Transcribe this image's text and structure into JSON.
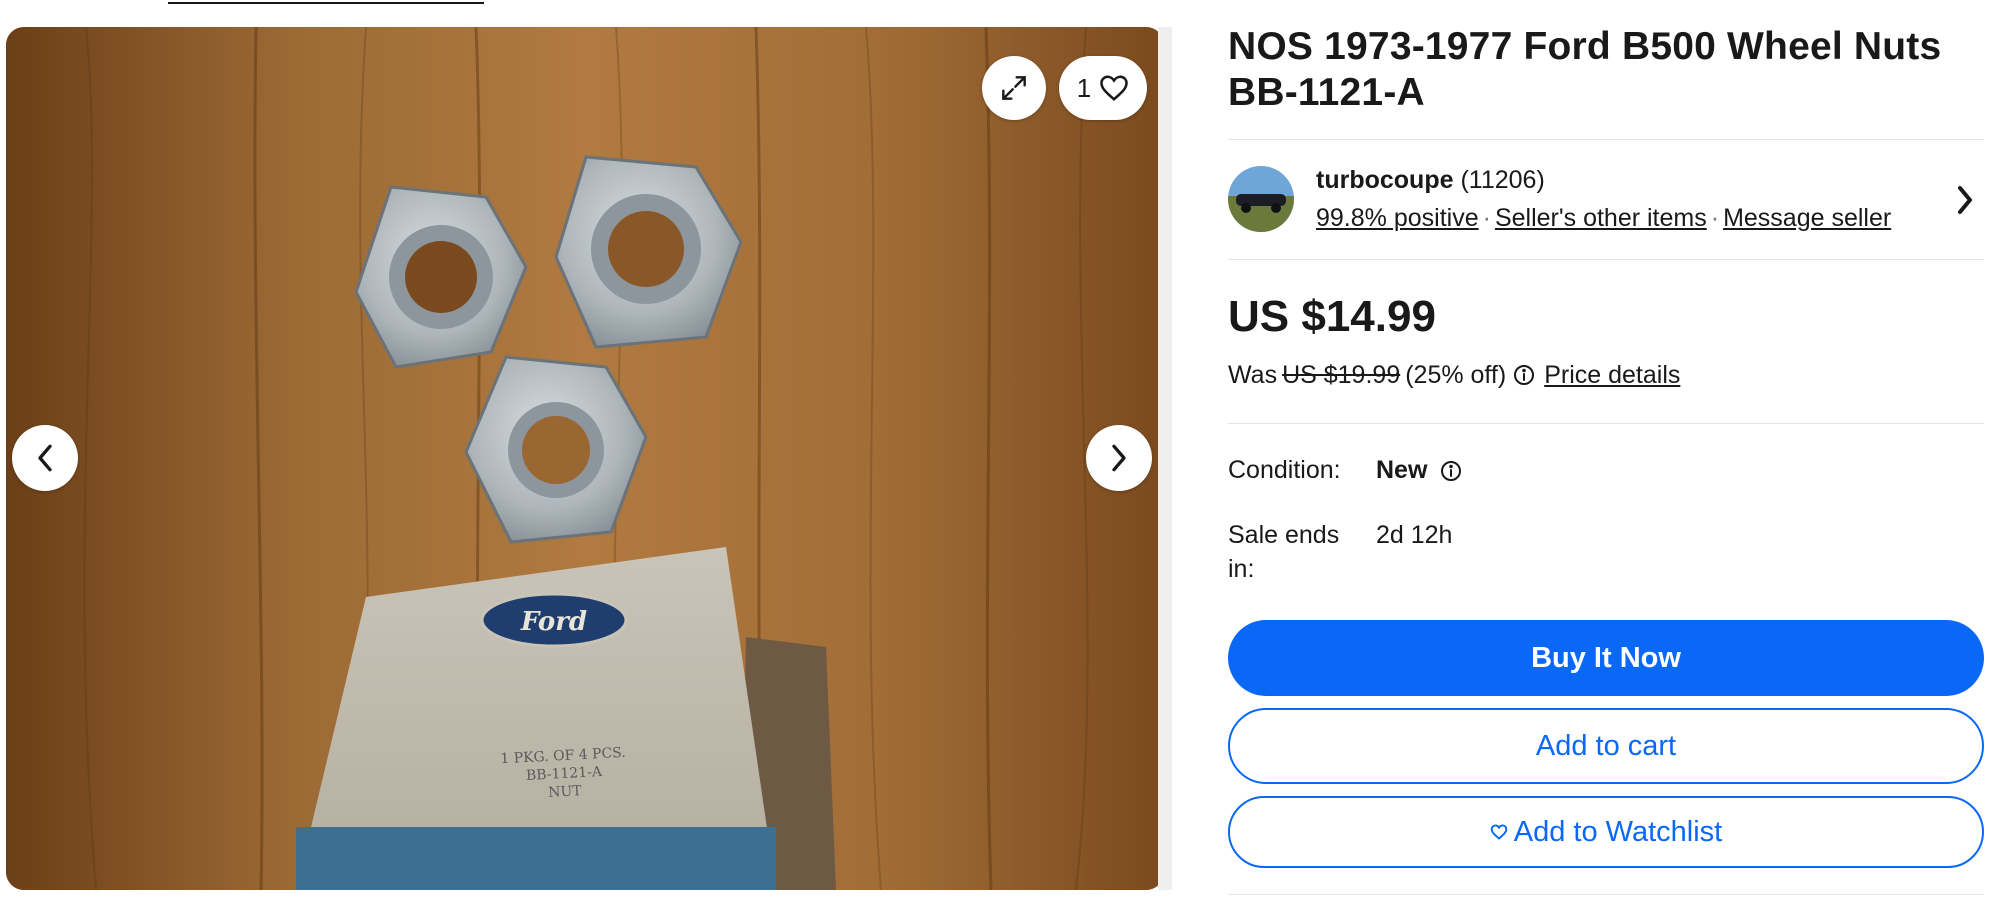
{
  "gallery": {
    "favorite_count": "1",
    "prev_label": "Previous image",
    "next_label": "Next image",
    "box_logo": "Ford",
    "box_text_line1": "1 PKG. OF 4 PCS.",
    "box_text_line2": "BB-1121-A",
    "box_text_line3": "NUT"
  },
  "listing": {
    "title": "NOS 1973-1977 Ford B500 Wheel Nuts BB-1121-A"
  },
  "seller": {
    "name": "turbocoupe",
    "feedback_count": "(11206)",
    "positive": "99.8% positive",
    "other_items": "Seller's other items",
    "message": "Message seller"
  },
  "price": {
    "current": "US $14.99",
    "was_label": "Was",
    "was_price": "US $19.99",
    "discount": "(25% off)",
    "details_link": "Price details"
  },
  "details": {
    "condition_label": "Condition:",
    "condition_value": "New",
    "sale_ends_label": "Sale ends in:",
    "sale_ends_value": "2d 12h"
  },
  "actions": {
    "buy_now": "Buy It Now",
    "add_to_cart": "Add to cart",
    "add_to_watchlist": "Add to Watchlist"
  },
  "colors": {
    "primary_blue": "#0968f6",
    "text": "#191919"
  }
}
